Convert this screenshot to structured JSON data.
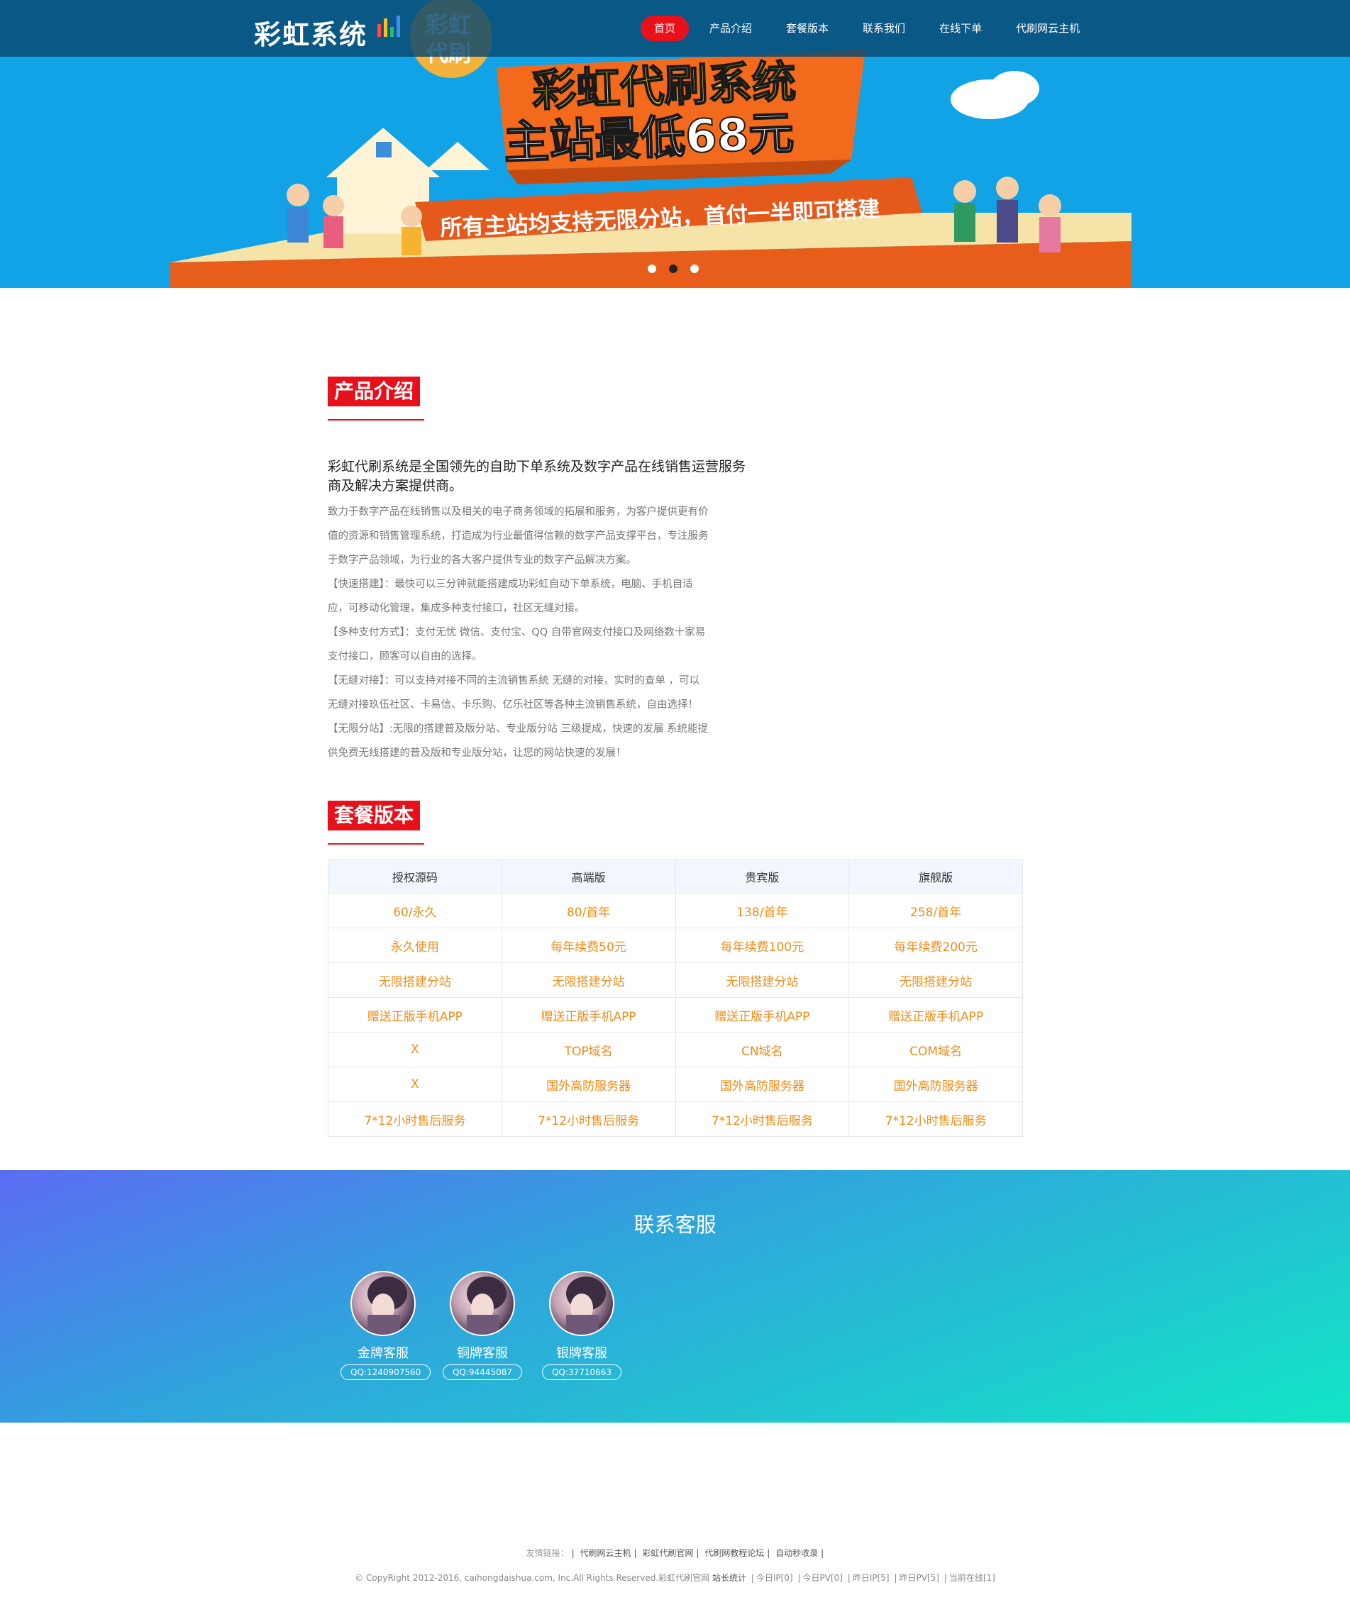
{
  "logo": {
    "text": "彩虹系统"
  },
  "banner": {
    "badge": [
      "彩虹",
      "代刷"
    ],
    "headline": "彩虹代刷系统",
    "subhead": "主站最低68元",
    "ribbon": "所有主站均支持无限分站，首付一半即可搭建"
  },
  "nav": [
    {
      "label": "首页",
      "active": true
    },
    {
      "label": "产品介绍"
    },
    {
      "label": "套餐版本"
    },
    {
      "label": "联系我们"
    },
    {
      "label": "在线下单"
    },
    {
      "label": "代刷网云主机"
    }
  ],
  "intro": {
    "title": "产品介绍",
    "lead": "彩虹代刷系统是全国领先的自助下单系统及数字产品在线销售运营服务商及解决方案提供商。",
    "lines": [
      "致力于数字产品在线销售以及相关的电子商务领域的拓展和服务，为客户提供更有价",
      "值的资源和销售管理系统，打造成为行业最值得信赖的数字产品支撑平台，专注服务",
      "于数字产品领域，为行业的各大客户提供专业的数字产品解决方案。",
      "【快速搭建】：最快可以三分钟就能搭建成功彩虹自动下单系统，电脑、手机自适",
      "应，可移动化管理，集成多种支付接口，社区无缝对接。",
      "【多种支付方式】：支付无忧 微信、支付宝、QQ 自带官网支付接口及网络数十家易",
      "支付接口，顾客可以自由的选择。",
      "【无缝对接】：可以支持对接不同的主流销售系统 无缝的对接，实时的查单 ，可以",
      "无缝对接玖伍社区、卡易信、卡乐购、亿乐社区等各种主流销售系统，自由选择！",
      "【无限分站】:无限的搭建普及版分站、专业版分站 三级提成，快速的发展 系统能提",
      "供免费无线搭建的普及版和专业版分站，让您的网站快速的发展！"
    ]
  },
  "pricing": {
    "title": "套餐版本",
    "headers": [
      "授权源码",
      "高端版",
      "贵宾版",
      "旗舰版"
    ],
    "rows": [
      [
        "60/永久",
        "80/首年",
        "138/首年",
        "258/首年"
      ],
      [
        "永久使用",
        "每年续费50元",
        "每年续费100元",
        "每年续费200元"
      ],
      [
        "无限搭建分站",
        "无限搭建分站",
        "无限搭建分站",
        "无限搭建分站"
      ],
      [
        "赠送正版手机APP",
        "赠送正版手机APP",
        "赠送正版手机APP",
        "赠送正版手机APP"
      ],
      [
        "X",
        "TOP域名",
        "CN域名",
        "COM域名"
      ],
      [
        "X",
        "国外高防服务器",
        "国外高防服务器",
        "国外高防服务器"
      ],
      [
        "7*12小时售后服务",
        "7*12小时售后服务",
        "7*12小时售后服务",
        "7*12小时售后服务"
      ]
    ]
  },
  "contact": {
    "title": "联系客服",
    "agents": [
      {
        "name": "金牌客服",
        "qq": "QQ:1240907560"
      },
      {
        "name": "铜牌客服",
        "qq": "QQ:94445087"
      },
      {
        "name": "银牌客服",
        "qq": "QQ:37710663"
      }
    ]
  },
  "footer": {
    "links_label": "友情链接：",
    "links": [
      "代刷网云主机",
      "彩虹代刷官网",
      "代刷网教程论坛",
      "自动秒收录"
    ],
    "copyright": "© CopyRight 2012-2016, caihongdaishua.com, Inc.All Rights Reserved.彩虹代刷官网",
    "stats": [
      "站长统计",
      "今日IP[0]",
      "今日PV[0]",
      "昨日IP[5]",
      "昨日PV[5]",
      "当前在线[1]"
    ]
  },
  "colors": {
    "accent": "#e8111b",
    "price": "#f08c17",
    "nav_bg": "#08486f",
    "banner_bg": "#11a3e6"
  }
}
